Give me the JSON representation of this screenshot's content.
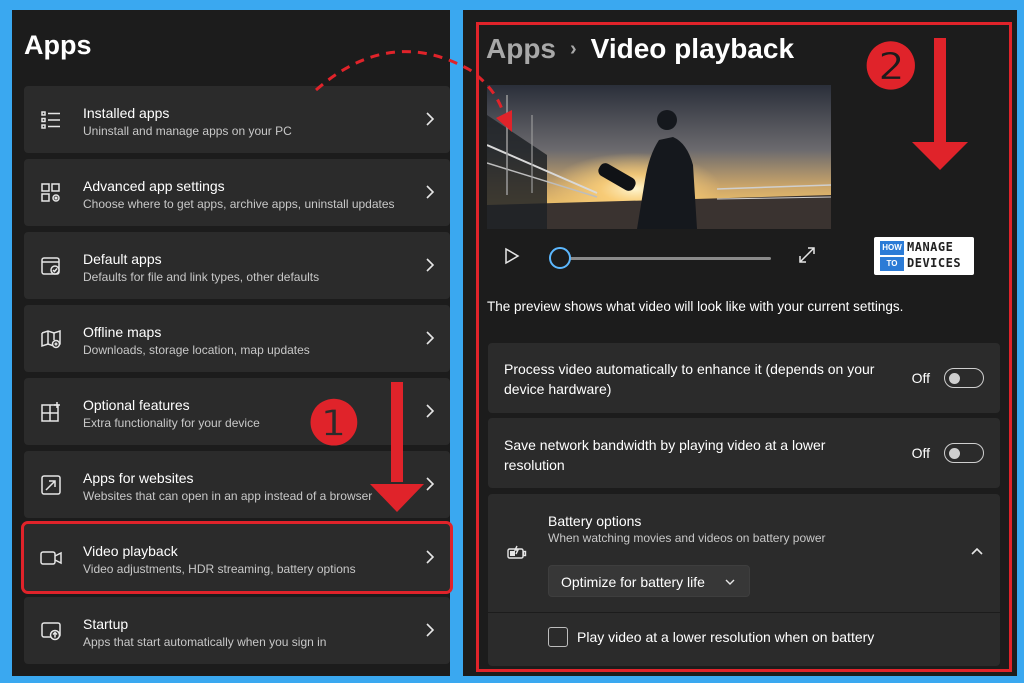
{
  "left": {
    "title": "Apps",
    "items": [
      {
        "title": "Installed apps",
        "subtitle": "Uninstall and manage apps on your PC",
        "icon": "list-icon"
      },
      {
        "title": "Advanced app settings",
        "subtitle": "Choose where to get apps, archive apps, uninstall updates",
        "icon": "app-settings-icon"
      },
      {
        "title": "Default apps",
        "subtitle": "Defaults for file and link types, other defaults",
        "icon": "default-apps-icon"
      },
      {
        "title": "Offline maps",
        "subtitle": "Downloads, storage location, map updates",
        "icon": "map-icon"
      },
      {
        "title": "Optional features",
        "subtitle": "Extra functionality for your device",
        "icon": "optional-features-icon"
      },
      {
        "title": "Apps for websites",
        "subtitle": "Websites that can open in an app instead of a browser",
        "icon": "link-app-icon"
      },
      {
        "title": "Video playback",
        "subtitle": "Video adjustments, HDR streaming, battery options",
        "icon": "video-camera-icon",
        "selected": true
      },
      {
        "title": "Startup",
        "subtitle": "Apps that start automatically when you sign in",
        "icon": "startup-icon"
      }
    ]
  },
  "right": {
    "breadcrumb": {
      "parent": "Apps",
      "separator": "›",
      "current": "Video playback"
    },
    "preview_text": "The preview shows what video will look like with your current settings.",
    "player": {
      "progress": 0.0
    },
    "settings": [
      {
        "label": "Process video automatically to enhance it (depends on your device hardware)",
        "state": "Off",
        "on": false
      },
      {
        "label": "Save network bandwidth by playing video at a lower resolution",
        "state": "Off",
        "on": false
      }
    ],
    "battery": {
      "title": "Battery options",
      "subtitle": "When watching movies and videos on battery power",
      "dropdown_value": "Optimize for battery life",
      "checkbox_label": "Play video at a lower resolution when on battery",
      "checked": false
    }
  },
  "logo": {
    "how": "HOW",
    "to": "TO",
    "manage": "MANAGE",
    "devices": "DEVICES"
  },
  "annotations": {
    "step1": "❶",
    "step2": "❷"
  },
  "colors": {
    "accent_red": "#e0232a",
    "panel_bg": "#1c1c1c",
    "card_bg": "#2b2b2b",
    "page_bg": "#3aa8f0",
    "seek_accent": "#5cb8ff"
  }
}
